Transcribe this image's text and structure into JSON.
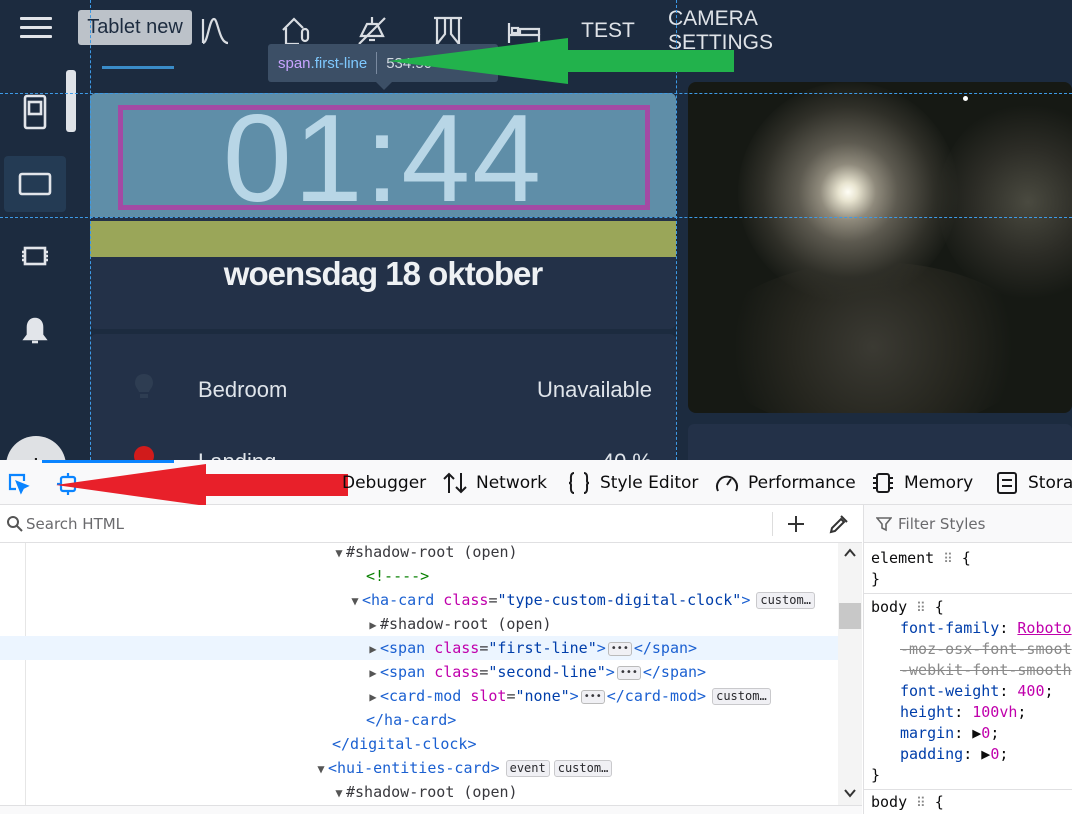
{
  "app": {
    "dashboard_tab": "Tablet new",
    "tabs": [
      {
        "label": "TEST"
      },
      {
        "label": "CAMERA SETTINGS"
      }
    ],
    "tooltip": {
      "tag": "span",
      "cls": ".first-line",
      "size": "534.50"
    },
    "clock": {
      "time": "01:44",
      "date": "woensdag 18 oktober"
    },
    "entities": [
      {
        "name": "Bedroom",
        "state": "Unavailable"
      },
      {
        "name": "Landing",
        "state": "40 %"
      }
    ],
    "avatar_initial": "I",
    "colors": {
      "accent": "#3a8cc8",
      "highlight": "#a34aa4",
      "olive": "#9aa659",
      "arrow_green": "#22b24c",
      "arrow_red": "#e8202a"
    }
  },
  "devtools": {
    "tabs": [
      {
        "label": "Debugger"
      },
      {
        "label": "Network"
      },
      {
        "label": "Style Editor"
      },
      {
        "label": "Performance"
      },
      {
        "label": "Memory"
      },
      {
        "label": "Storag"
      }
    ],
    "search_placeholder": "Search HTML",
    "markup": {
      "l1": "#shadow-root (open)",
      "l2": "<!---->",
      "l3_tag": "ha-card",
      "l3_attr": "class",
      "l3_val": "\"type-custom-digital-clock\"",
      "l3_badge": "custom…",
      "l4": "#shadow-root (open)",
      "l5_val": "\"first-line\"",
      "l6_val": "\"second-line\"",
      "l7_tag": "card-mod",
      "l7_attr": "slot",
      "l7_val": "\"none\"",
      "l7_badge": "custom…",
      "l8": "</ha-card>",
      "l9": "</digital-clock>",
      "l10_tag": "hui-entities-card",
      "l10_badge1": "event",
      "l10_badge2": "custom…",
      "l11": "#shadow-root (open)"
    },
    "rules": {
      "filter_placeholder": "Filter Styles",
      "element_selector": "element",
      "body_selector": "body",
      "props": [
        {
          "name": "font-family",
          "value": "Roboto"
        },
        {
          "name": "-moz-osx-font-smoot",
          "value": ""
        },
        {
          "name": "-webkit-font-smooth",
          "value": ""
        },
        {
          "name": "font-weight",
          "value": "400"
        },
        {
          "name": "height",
          "value": "100vh"
        },
        {
          "name": "margin",
          "value": "0"
        },
        {
          "name": "padding",
          "value": "0"
        }
      ]
    }
  }
}
